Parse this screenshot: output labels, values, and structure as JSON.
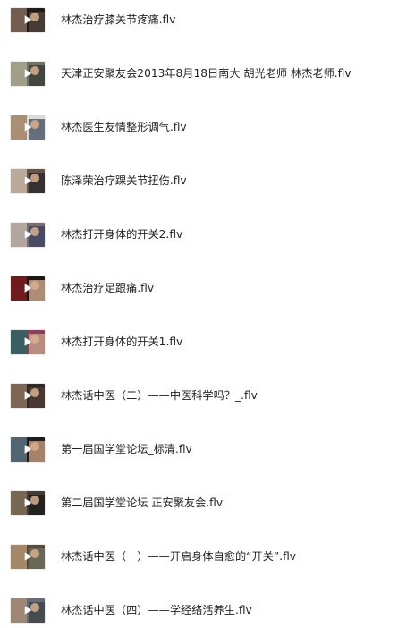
{
  "files": [
    {
      "name": "林杰治疗膝关节疼痛.flv",
      "icon": "video-thumbnail-icon",
      "colors": [
        "#1f1b19",
        "#8f7461",
        "#4e4038"
      ]
    },
    {
      "name": "天津正安聚友会2013年8月18日南大 胡光老师 林杰老师.flv",
      "icon": "video-thumbnail-icon",
      "colors": [
        "#6d7563",
        "#b3ad95",
        "#3c3f3a"
      ]
    },
    {
      "name": "林杰医生友情整形调气.flv",
      "icon": "video-thumbnail-icon",
      "colors": [
        "#d9ddd6",
        "#9b7453",
        "#4f5c6b"
      ]
    },
    {
      "name": "陈泽荣治疗踝关节扭伤.flv",
      "icon": "video-thumbnail-icon",
      "colors": [
        "#6a5446",
        "#d6c6b4",
        "#2b2b2e"
      ]
    },
    {
      "name": "林杰打开身体的开关2.flv",
      "icon": "video-thumbnail-icon",
      "colors": [
        "#7d6e6b",
        "#c4b9af",
        "#3e4762"
      ]
    },
    {
      "name": "林杰治疗足跟痛.flv",
      "icon": "video-thumbnail-icon",
      "colors": [
        "#1d1414",
        "#8b1d21",
        "#c7a287"
      ]
    },
    {
      "name": "林杰打开身体的开关1.flv",
      "icon": "video-thumbnail-icon",
      "colors": [
        "#8f3e59",
        "#1d6b65",
        "#c19b87"
      ]
    },
    {
      "name": "林杰话中医（二）——中医科学吗？_.flv",
      "icon": "video-thumbnail-icon",
      "colors": [
        "#2f2926",
        "#9b7b63",
        "#4b3c35"
      ]
    },
    {
      "name": "第一届国学堂论坛_标清.flv",
      "icon": "video-thumbnail-icon",
      "colors": [
        "#1c1d1d",
        "#627d8d",
        "#c09478"
      ]
    },
    {
      "name": "第二届国学堂论坛 正安聚友会.flv",
      "icon": "video-thumbnail-icon",
      "colors": [
        "#473b31",
        "#88785f",
        "#1f1f1d"
      ]
    },
    {
      "name": "林杰话中医（一）——开启身体自愈的“开关”.flv",
      "icon": "video-thumbnail-icon",
      "colors": [
        "#5a4a3a",
        "#be9d78",
        "#6c6d5b"
      ]
    },
    {
      "name": "林杰话中医（四）——学经络活养生.flv",
      "icon": "video-thumbnail-icon",
      "colors": [
        "#666d7a",
        "#b19073",
        "#404749"
      ]
    }
  ]
}
